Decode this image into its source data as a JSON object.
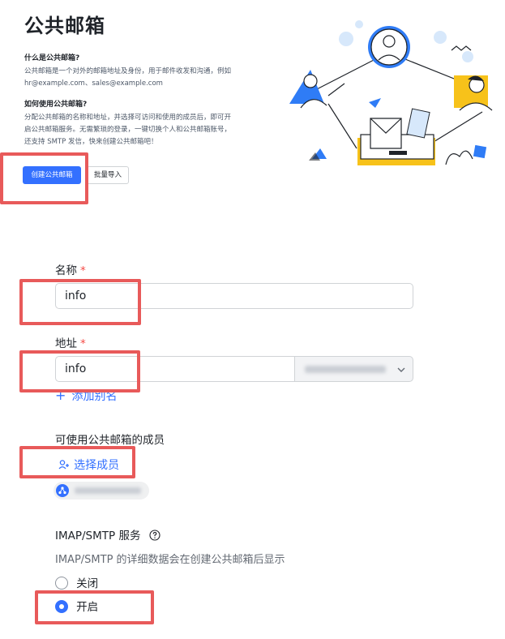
{
  "header": {
    "title": "公共邮箱",
    "q1": "什么是公共邮箱?",
    "p1": [
      "公共邮箱是一个对外的邮箱地址及身份，用于邮件收发和沟通，例如",
      "hr@example.com、sales@example.com"
    ],
    "q2": "如何使用公共邮箱?",
    "p2": [
      "分配公共邮箱的名称和地址，并选择可访问和使用的成员后，即可开",
      "启公共邮箱服务。无需繁琐的登录，一键切换个人和公共邮箱账号，",
      "还支持 SMTP 发信，快来创建公共邮箱吧！"
    ],
    "create_label": "创建公共邮箱",
    "import_label": "批量导入"
  },
  "form": {
    "name_label": "名称",
    "name_value": "info",
    "address_label": "地址",
    "address_value": "info",
    "add_alias_label": "添加别名",
    "members_label": "可使用公共邮箱的成员",
    "select_members_label": "选择成员",
    "imap_label": "IMAP/SMTP 服务",
    "imap_hint": "IMAP/SMTP 的详细数据会在创建公共邮箱后显示",
    "radio_off_label": "关闭",
    "radio_on_label": "开启",
    "radio_selected": "开启",
    "required_mark": "*"
  },
  "icons": {
    "add": "plus-icon",
    "members": "add-user-icon",
    "help": "question-circle-icon",
    "dropdown": "chevron-down-icon",
    "avatar": "group-avatar-icon"
  },
  "colors": {
    "accent": "#3370ff",
    "required": "#f54a45",
    "highlight": "#e85a5a",
    "illustration_blue": "#2f7cf6",
    "illustration_yellow": "#f7c21a"
  }
}
